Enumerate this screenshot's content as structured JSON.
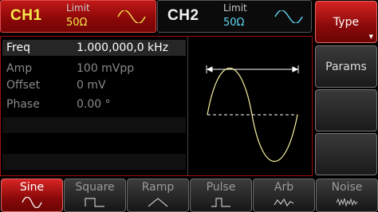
{
  "channels": [
    {
      "name": "CH1",
      "limit_label": "Limit",
      "limit_value": "50Ω",
      "waveform_icon": "sine-icon",
      "color": "#f4e94a"
    },
    {
      "name": "CH2",
      "limit_label": "Limit",
      "limit_value": "50Ω",
      "waveform_icon": "sine-icon",
      "color": "#5ed7f2"
    }
  ],
  "softkeys": [
    {
      "label": "Type",
      "active": true
    },
    {
      "label": "Params",
      "active": false
    },
    {
      "label": "",
      "active": false
    },
    {
      "label": "",
      "active": false
    }
  ],
  "parameters": [
    {
      "name": "Freq",
      "value": "1.000,000,0 kHz",
      "selected": true
    },
    {
      "name": "Amp",
      "value": "100 mVpp",
      "selected": false
    },
    {
      "name": "Offset",
      "value": "0 mV",
      "selected": false
    },
    {
      "name": "Phase",
      "value": "0.00 °",
      "selected": false
    }
  ],
  "preview": {
    "waveform": "sine",
    "trace_color": "#f6f0a0"
  },
  "function_tabs": [
    {
      "label": "Sine",
      "icon": "sine-icon",
      "active": true
    },
    {
      "label": "Square",
      "icon": "square-wave-icon",
      "active": false
    },
    {
      "label": "Ramp",
      "icon": "ramp-wave-icon",
      "active": false
    },
    {
      "label": "Pulse",
      "icon": "pulse-wave-icon",
      "active": false
    },
    {
      "label": "Arb",
      "icon": "arb-wave-icon",
      "active": false
    },
    {
      "label": "Noise",
      "icon": "noise-wave-icon",
      "active": false
    }
  ]
}
